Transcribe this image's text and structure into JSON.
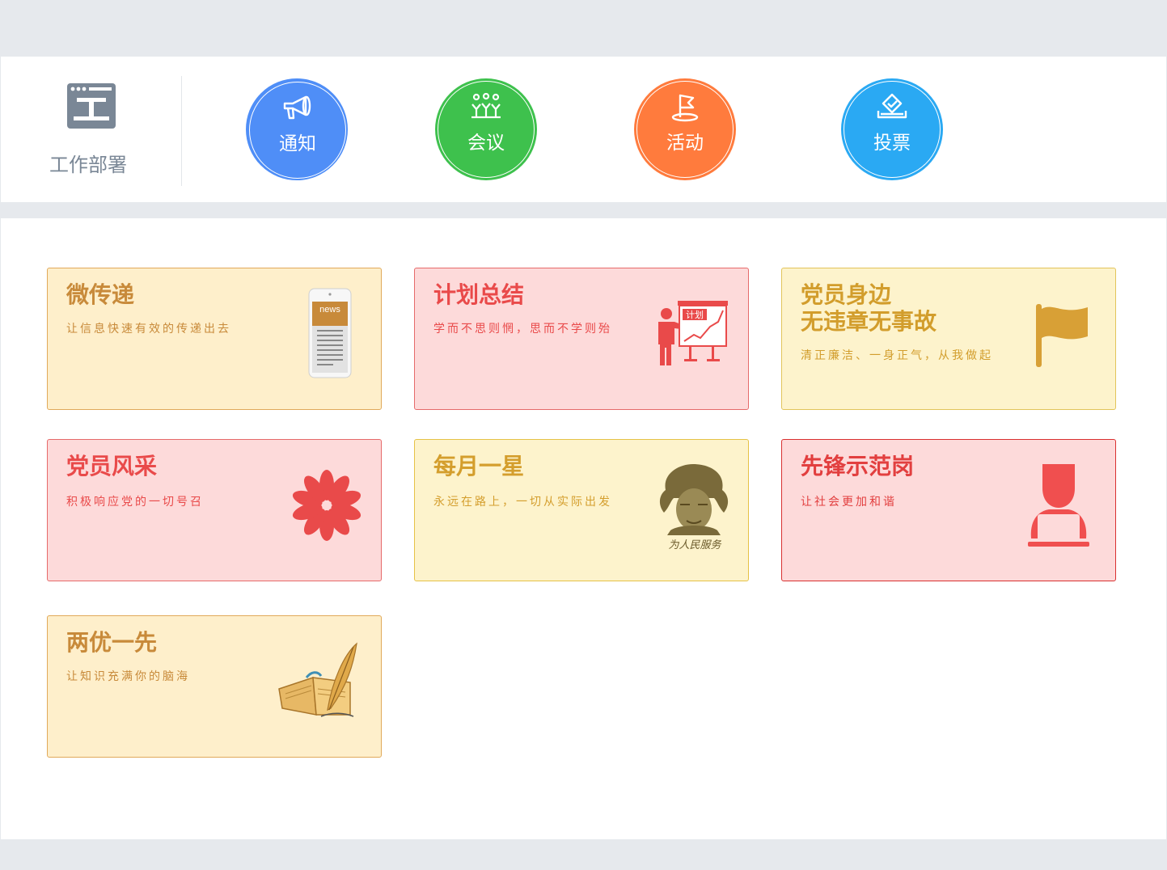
{
  "section": {
    "title": "工作部署",
    "icon": "work-deploy-icon"
  },
  "quick_actions": [
    {
      "label": "通知",
      "icon": "megaphone-icon",
      "color": "#4f8ef7"
    },
    {
      "label": "会议",
      "icon": "meeting-icon",
      "color": "#3ec14d"
    },
    {
      "label": "活动",
      "icon": "flag-activity-icon",
      "color": "#ff7b3d"
    },
    {
      "label": "投票",
      "icon": "ballot-box-icon",
      "color": "#2aa9f3"
    }
  ],
  "cards": [
    {
      "title": "微传递",
      "subtitle": "让信息快速有效的传递出去",
      "icon": "phone-news-icon",
      "image_text": "news"
    },
    {
      "title": "计划总结",
      "subtitle": "学而不思则惘，思而不学则殆",
      "icon": "presenter-chart-icon",
      "image_text": "计划"
    },
    {
      "title_line1": "党员身边",
      "title_line2": "无违章无事故",
      "subtitle": "清正廉洁、一身正气，从我做起",
      "icon": "flag-icon"
    },
    {
      "title": "党员风采",
      "subtitle": "积极响应党的一切号召",
      "icon": "flower-icon"
    },
    {
      "title": "每月一星",
      "subtitle": "永远在路上，一切从实际出发",
      "icon": "portrait-icon",
      "image_text": "为人民服务"
    },
    {
      "title": "先锋示范岗",
      "subtitle": "让社会更加和谐",
      "icon": "person-laptop-icon"
    },
    {
      "title": "两优一先",
      "subtitle": "让知识充满你的脑海",
      "icon": "book-quill-icon"
    }
  ]
}
